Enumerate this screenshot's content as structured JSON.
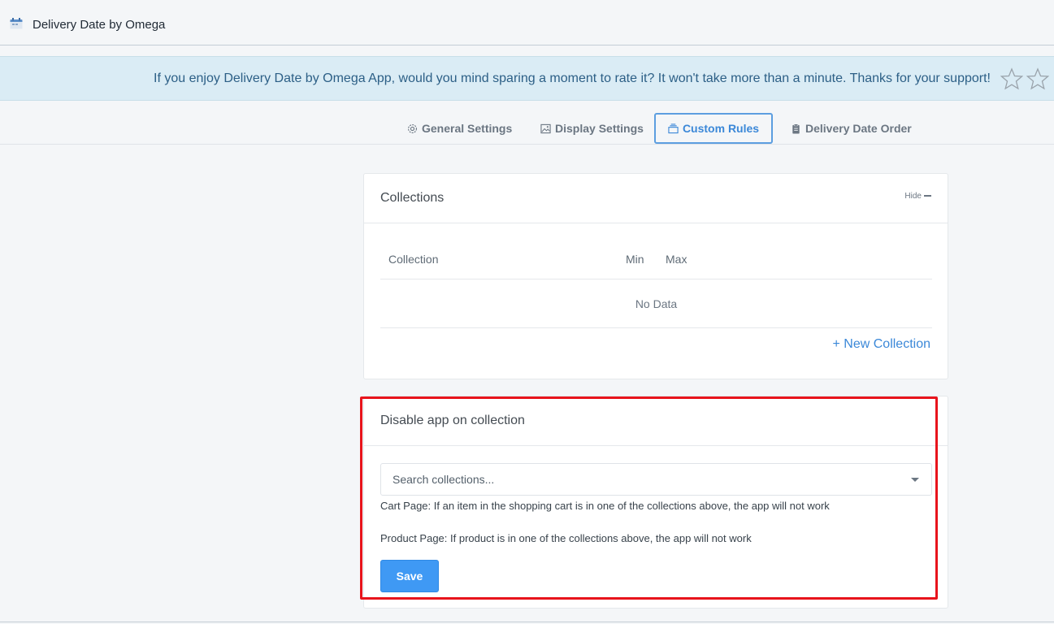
{
  "header": {
    "app_title": "Delivery Date by Omega",
    "icon": "calendar-icon"
  },
  "banner": {
    "text": "If you enjoy Delivery Date by Omega App, would you mind sparing a moment to rate it? It won't take more than a minute. Thanks for your support!",
    "stars_icon": "star-outline-icon"
  },
  "tabs": [
    {
      "label": "General Settings",
      "icon": "gear-icon",
      "active": false
    },
    {
      "label": "Display Settings",
      "icon": "image-icon",
      "active": false
    },
    {
      "label": "Custom Rules",
      "icon": "stack-icon",
      "active": true
    },
    {
      "label": "Delivery Date Order",
      "icon": "clipboard-icon",
      "active": false
    }
  ],
  "collections_card": {
    "title": "Collections",
    "hide_label": "Hide",
    "columns": [
      "Collection",
      "Min",
      "Max"
    ],
    "empty_text": "No Data",
    "new_link": "+ New Collection"
  },
  "disable_card": {
    "title": "Disable app on collection",
    "search_placeholder": "Search collections...",
    "cart_help": "Cart Page: If an item in the shopping cart is in one of the collections above, the app will not work",
    "product_help": "Product Page: If product is in one of the collections above, the app will not work",
    "save_label": "Save"
  },
  "colors": {
    "accent": "#3f99f4",
    "banner_bg": "#daecf5",
    "highlight": "#e8141c"
  }
}
